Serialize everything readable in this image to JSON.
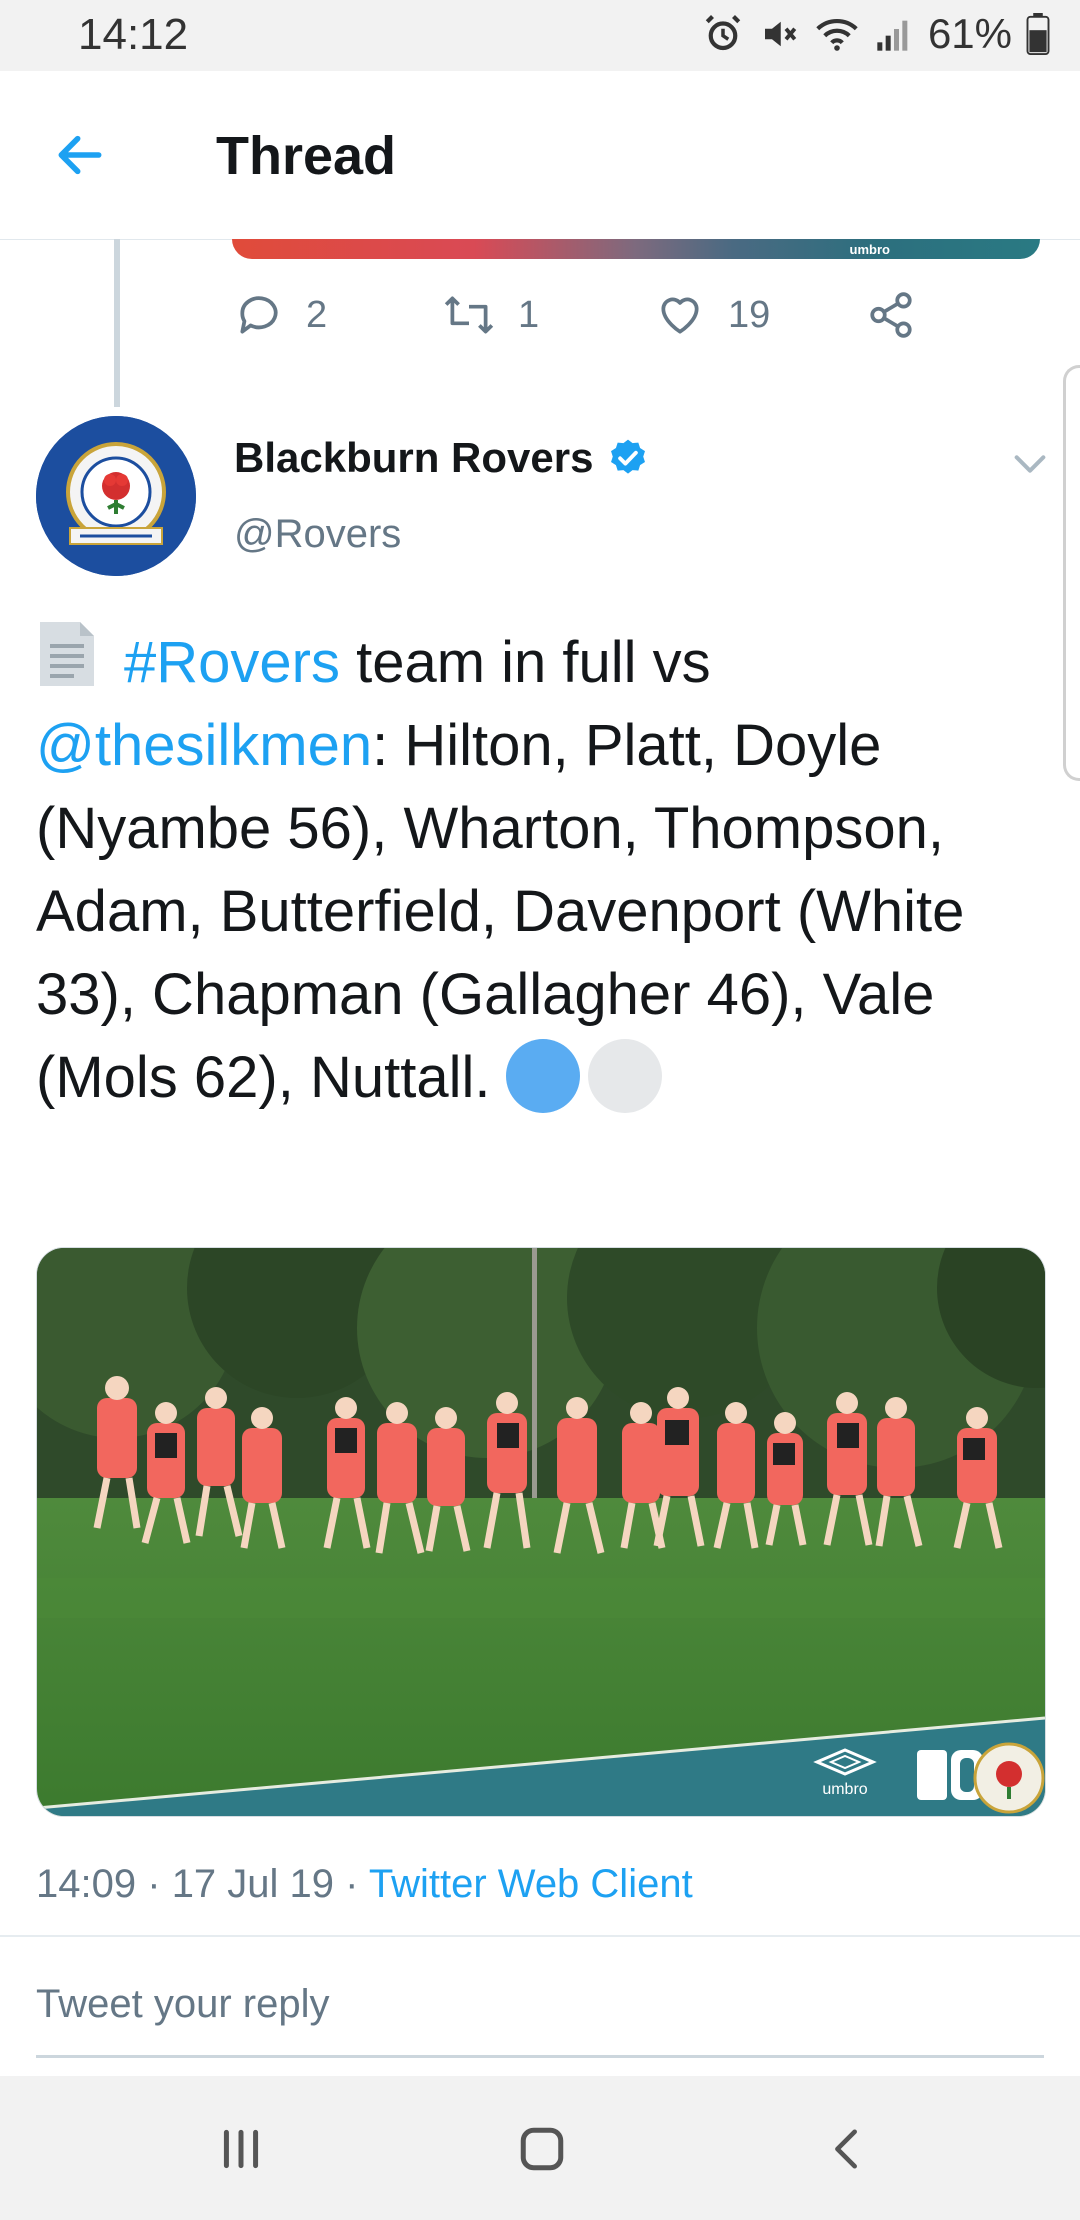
{
  "status_bar": {
    "time": "14:12",
    "battery_percent": "61%",
    "icons": [
      "alarm-icon",
      "mute-icon",
      "wifi-icon",
      "signal-icon",
      "battery-icon"
    ]
  },
  "app_bar": {
    "back_icon": "arrow-left-icon",
    "title": "Thread"
  },
  "previous_tweet": {
    "actions": {
      "replies": "2",
      "retweets": "1",
      "likes": "19"
    }
  },
  "tweet": {
    "author_name": "Blackburn Rovers",
    "verified": true,
    "handle": "@Rovers",
    "text": {
      "hashtag": "#Rovers",
      "part1": " team in full vs ",
      "mention": "@thesilkmen",
      "part2": ": Hilton, Platt, Doyle (Nyambe 56), Wharton, Thompson, Adam, Butterfield, Davenport (White 33), Chapman (Gallagher 46), Vale (Mols 62), Nuttall."
    },
    "emoji": [
      "page-facing-up-emoji",
      "blue-circle-emoji",
      "white-circle-emoji"
    ],
    "time": "14:09",
    "date": "17 Jul 19",
    "separator": "·",
    "client": "Twitter Web Client",
    "image_watermarks": [
      "umbro",
      "10BET"
    ]
  },
  "reply_box": {
    "placeholder": "Tweet your reply"
  },
  "nav_bar": {
    "buttons": [
      "recent-apps-icon",
      "home-icon",
      "back-icon"
    ]
  },
  "colors": {
    "link": "#1da1f2",
    "muted": "#657786",
    "kit": "#f2675e"
  }
}
